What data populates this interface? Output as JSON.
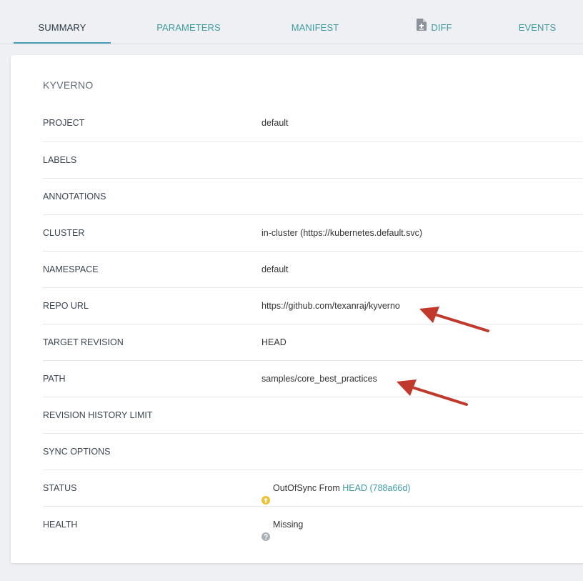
{
  "tabs": [
    {
      "label": "SUMMARY",
      "active": true
    },
    {
      "label": "PARAMETERS",
      "active": false
    },
    {
      "label": "MANIFEST",
      "active": false
    },
    {
      "label": "DIFF",
      "active": false
    },
    {
      "label": "EVENTS",
      "active": false
    }
  ],
  "app": {
    "name": "KYVERNO"
  },
  "fields": {
    "project": {
      "label": "PROJECT",
      "value": "default"
    },
    "labels": {
      "label": "LABELS",
      "value": ""
    },
    "annotations": {
      "label": "ANNOTATIONS",
      "value": ""
    },
    "cluster": {
      "label": "CLUSTER",
      "value": "in-cluster (https://kubernetes.default.svc)"
    },
    "namespace": {
      "label": "NAMESPACE",
      "value": "default"
    },
    "repo_url": {
      "label": "REPO URL",
      "value": "https://github.com/texanraj/kyverno"
    },
    "target_revision": {
      "label": "TARGET REVISION",
      "value": "HEAD"
    },
    "path": {
      "label": "PATH",
      "value": "samples/core_best_practices"
    },
    "revision_history_limit": {
      "label": "REVISION HISTORY LIMIT",
      "value": ""
    },
    "sync_options": {
      "label": "SYNC OPTIONS",
      "value": ""
    },
    "status": {
      "label": "STATUS",
      "text": "OutOfSync From",
      "revision_link": "HEAD (788a66d)",
      "icon": "arrow-up-circle-icon"
    },
    "health": {
      "label": "HEALTH",
      "text": "Missing",
      "icon": "question-circle-icon"
    }
  },
  "colors": {
    "link": "#3e9ba2",
    "tab_underline": "#4a9fb5",
    "out_of_sync": "#f4c030",
    "missing": "#a8b0b8",
    "annotation_arrow": "#c0392b"
  }
}
